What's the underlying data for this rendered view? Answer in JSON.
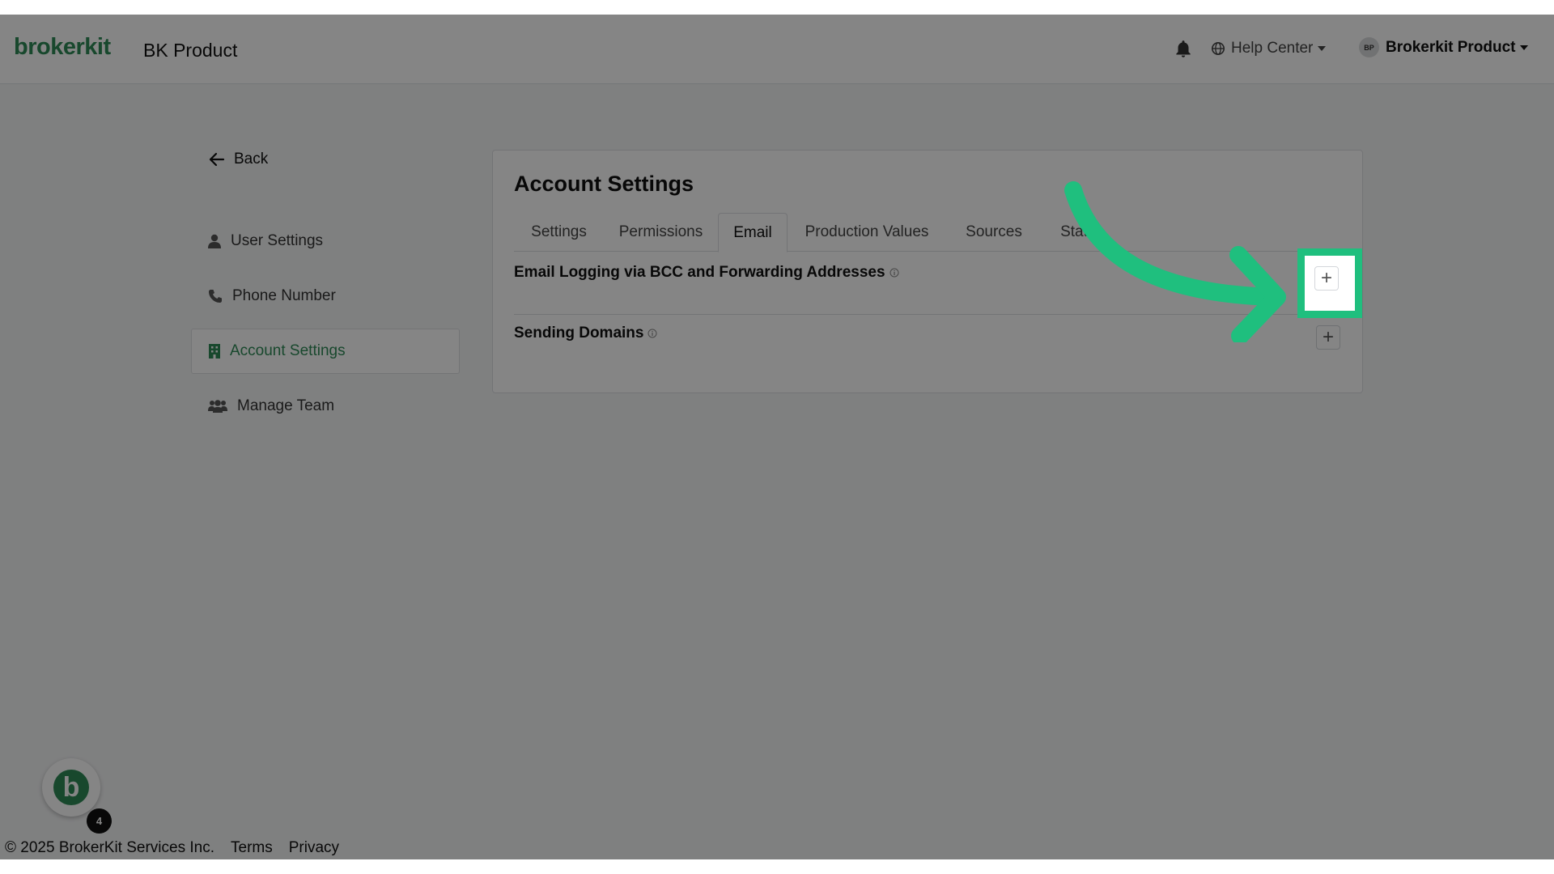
{
  "header": {
    "logo": "brokerkit",
    "product_name": "BK Product",
    "bell_icon": "bell-icon",
    "help_center_label": "Help Center",
    "user_initials": "BP",
    "user_name": "Brokerkit Product"
  },
  "nav": {
    "back_label": "Back",
    "items": [
      {
        "label": "User Settings",
        "icon": "user-icon"
      },
      {
        "label": "Phone Number",
        "icon": "phone-icon"
      },
      {
        "label": "Account Settings",
        "icon": "building-icon",
        "active": true
      },
      {
        "label": "Manage Team",
        "icon": "users-icon"
      }
    ]
  },
  "card": {
    "title": "Account Settings",
    "tabs": [
      "Settings",
      "Permissions",
      "Email",
      "Production Values",
      "Sources",
      "Status"
    ],
    "active_tab": "Email",
    "sections": [
      {
        "label": "Email Logging via BCC and Forwarding Addresses"
      },
      {
        "label": "Sending Domains"
      }
    ],
    "add_symbol": "+"
  },
  "footer": {
    "copyright": "© 2025 BrokerKit Services Inc.",
    "terms": "Terms",
    "privacy": "Privacy"
  },
  "chat": {
    "letter": "b",
    "badge_count": "4"
  },
  "colors": {
    "brand": "#2f8b57",
    "highlight": "#1fbf7e"
  }
}
